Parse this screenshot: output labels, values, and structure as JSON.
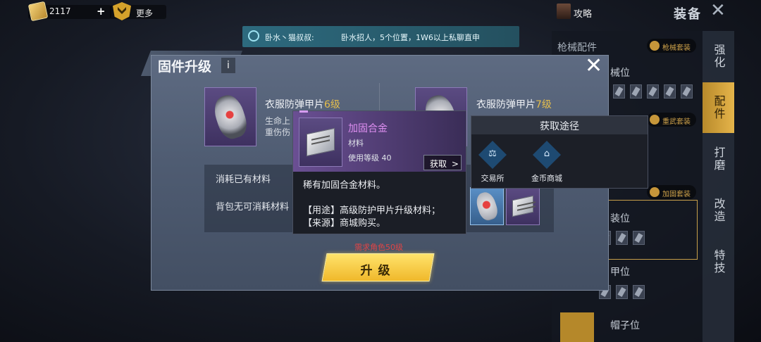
{
  "topbar": {
    "currency_value": "2117",
    "plus_label": "+",
    "more_label": "更多",
    "strategy_label": "攻略",
    "screen_title": "装备",
    "close_symbol": "✕"
  },
  "chat": {
    "sender": "卧水丶猫叔叔:",
    "message": "卧水招人，5个位置，1W6以上私聊直申"
  },
  "side_panel": {
    "heading": "枪械配件",
    "tabs": [
      "强化",
      "配件",
      "打磨",
      "改造",
      "特技"
    ],
    "active_tab": "配件",
    "set_tags": [
      "枪械套装",
      "重武套装",
      "加固套装"
    ],
    "slot_labels": [
      "械位",
      "装位",
      "甲位",
      "帽子位"
    ]
  },
  "dialog": {
    "title": "固件升级",
    "info_symbol": "i",
    "close_symbol": "✕",
    "current_item": {
      "name": "衣服防弹甲片",
      "level": "6级",
      "stat_line1": "生命上",
      "stat_line2": "重伤伤"
    },
    "next_item": {
      "name": "衣服防弹甲片",
      "level": "7级"
    },
    "consume_label": "消耗已有材料",
    "bag_label": "背包无可消耗材料",
    "requirement": "需求角色50级",
    "upgrade_label": "升级"
  },
  "tooltip": {
    "name": "加固合金",
    "type": "材料",
    "level_req": "使用等级 40",
    "get_label": "获取",
    "get_arrow": ">",
    "description": "稀有加固合金材料。",
    "usage": "【用途】高级防护甲片升级材料；",
    "source": "【来源】商城购买。"
  },
  "route_panel": {
    "title": "获取途径",
    "options": [
      {
        "label": "交易所",
        "icon": "gavel-icon",
        "glyph": "⚖"
      },
      {
        "label": "金币商城",
        "icon": "basket-icon",
        "glyph": "⌂"
      }
    ]
  },
  "colors": {
    "accent_gold": "#e4bd4c",
    "rare_purple": "#dd8ef0",
    "warning_red": "#e04545"
  }
}
